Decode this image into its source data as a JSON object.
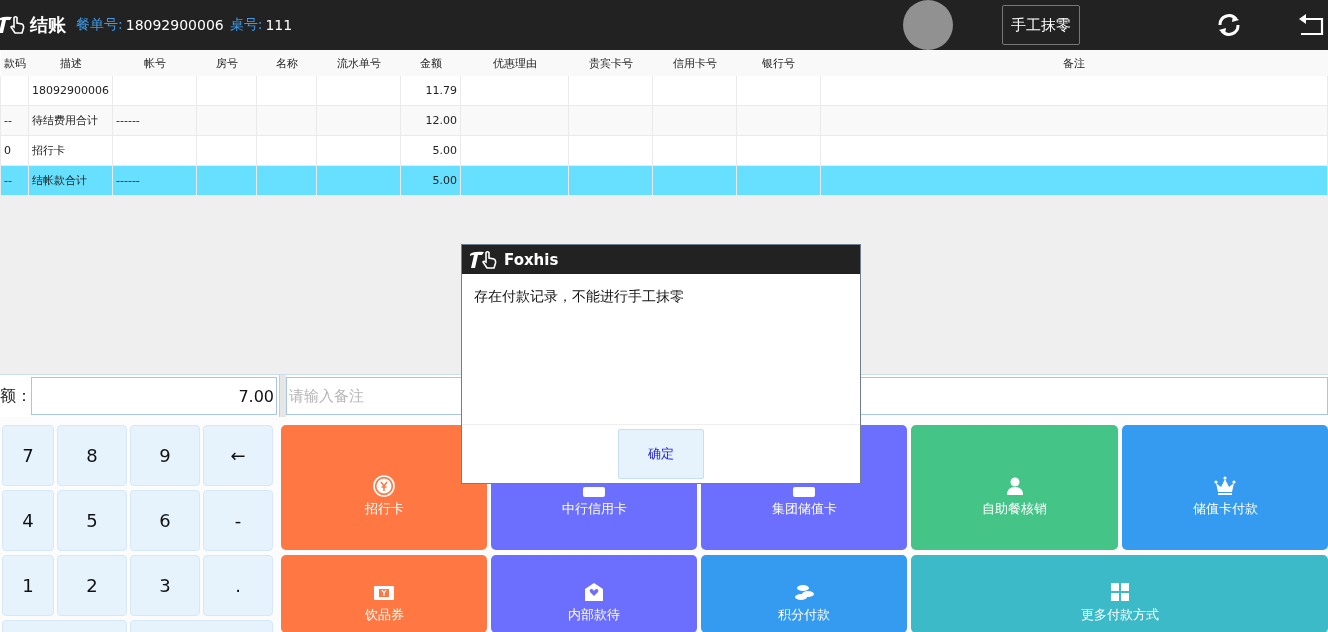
{
  "header": {
    "title": "结账",
    "order_label": "餐单号:",
    "order_no": "18092900006",
    "table_label": "桌号:",
    "table_no": "111",
    "manual_button": "手工抹零"
  },
  "table": {
    "columns": [
      "款码",
      "描述",
      "帐号",
      "房号",
      "名称",
      "流水单号",
      "金额",
      "优惠理由",
      "贵宾卡号",
      "信用卡号",
      "银行号",
      "备注"
    ],
    "rows": [
      {
        "cells": [
          null,
          "18092900006",
          null,
          null,
          null,
          null,
          "11.79",
          null,
          null,
          null,
          null,
          null
        ],
        "selected": false
      },
      {
        "cells": [
          "--",
          "待结费用合计",
          "------",
          null,
          null,
          null,
          "12.00",
          null,
          null,
          null,
          null,
          null
        ],
        "selected": false
      },
      {
        "cells": [
          "0",
          "招行卡",
          null,
          null,
          null,
          null,
          "5.00",
          null,
          null,
          null,
          null,
          null
        ],
        "selected": false
      },
      {
        "cells": [
          "--",
          "结帐款合计",
          "------",
          null,
          null,
          null,
          "5.00",
          null,
          null,
          null,
          null,
          null
        ],
        "selected": true
      }
    ]
  },
  "amount": {
    "label": "额：",
    "value": "7.00"
  },
  "remark": {
    "placeholder": "请输入备注"
  },
  "keypad": [
    "7",
    "8",
    "9",
    "←",
    "4",
    "5",
    "6",
    "-",
    "1",
    "2",
    "3",
    "."
  ],
  "payment_buttons": [
    {
      "label": "招行卡",
      "color": "#ff7843",
      "kind": "coin"
    },
    {
      "label": "中行信用卡",
      "color": "#6c6ffe",
      "kind": "card"
    },
    {
      "label": "集团储值卡",
      "color": "#6c6ffe",
      "kind": "card"
    },
    {
      "label": "自助餐核销",
      "color": "#44c487",
      "kind": "person"
    },
    {
      "label": "储值卡付款",
      "color": "#349bf1",
      "kind": "crown"
    },
    {
      "label": "饮品券",
      "color": "#ff7843",
      "kind": "ticket"
    },
    {
      "label": "内部款待",
      "color": "#6c6ffe",
      "kind": "heart"
    },
    {
      "label": "积分付款",
      "color": "#349bf1",
      "kind": "coins"
    },
    {
      "label": "更多付款方式",
      "color": "#3dbac8",
      "kind": "grid",
      "wide": true
    }
  ],
  "dialog": {
    "title": "Foxhis",
    "message": "存在付款记录，不能进行手工抹零",
    "button": "确定"
  }
}
